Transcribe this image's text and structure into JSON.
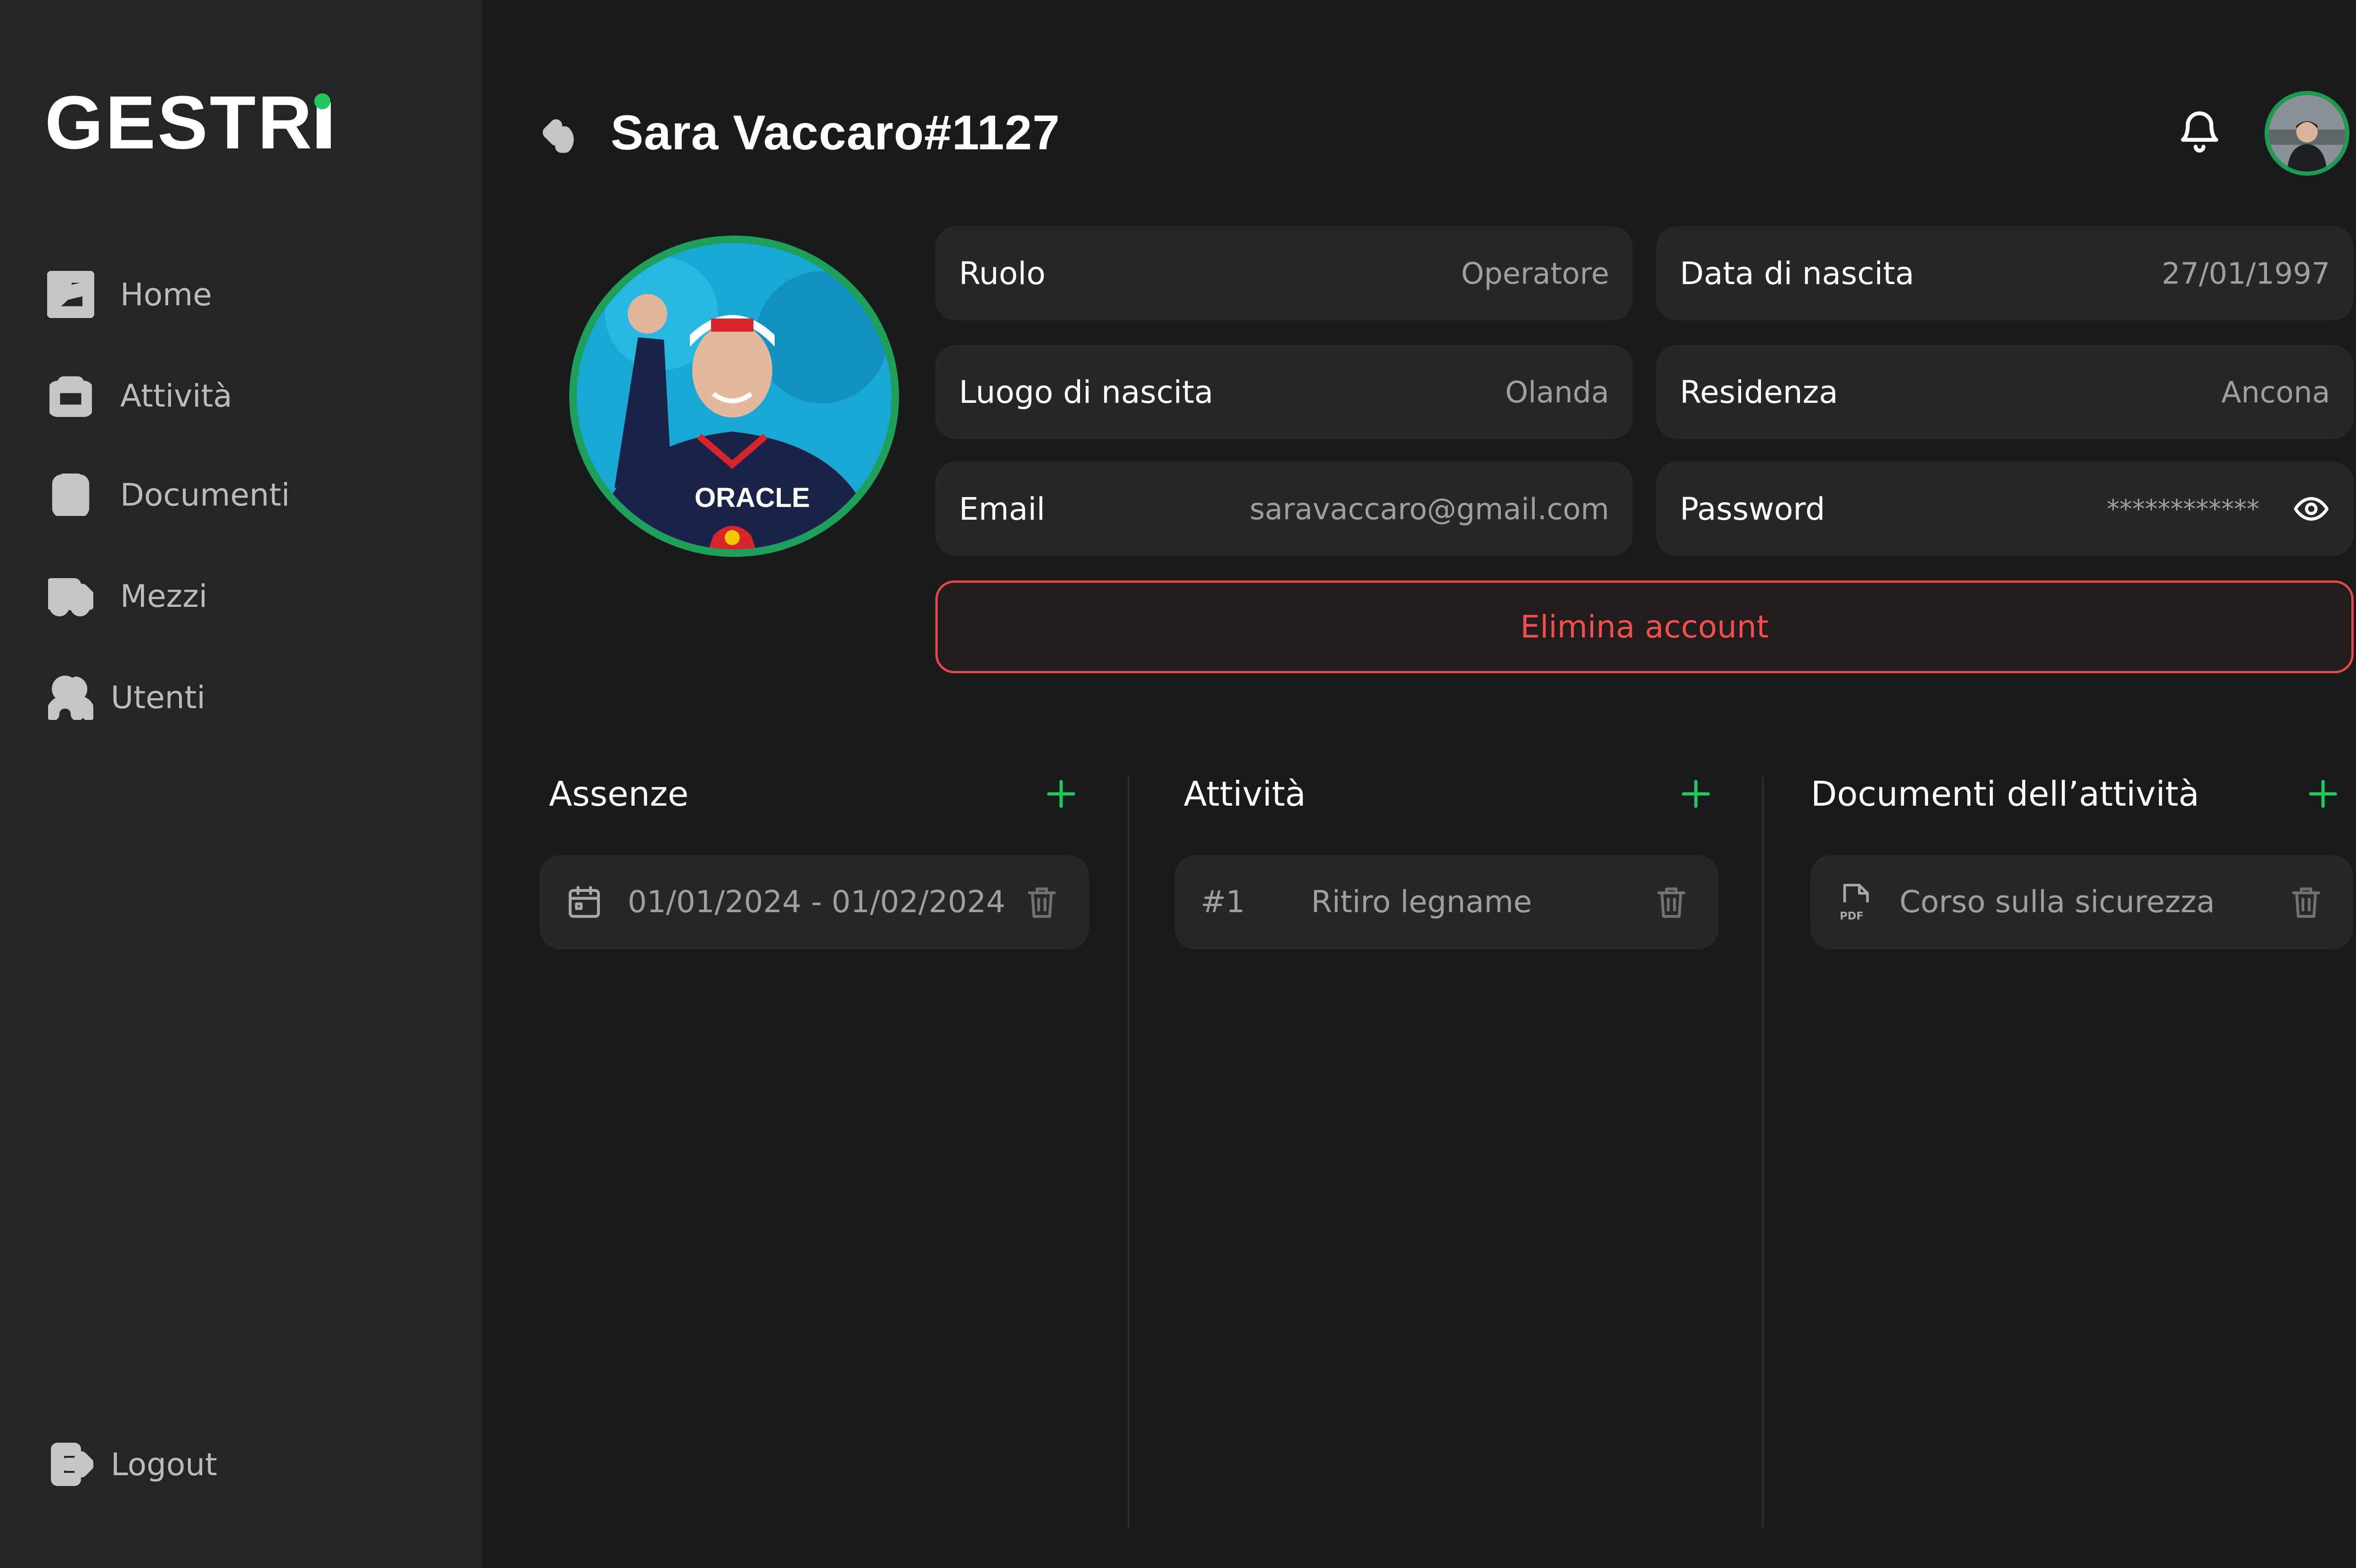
{
  "app": {
    "logo": "GESTR"
  },
  "sidebar": {
    "items": [
      {
        "label": "Home",
        "icon": "layout-icon"
      },
      {
        "label": "Attività",
        "icon": "briefcase-icon"
      },
      {
        "label": "Documenti",
        "icon": "clipboard-icon"
      },
      {
        "label": "Mezzi",
        "icon": "truck-icon"
      },
      {
        "label": "Utenti",
        "icon": "users-icon"
      }
    ],
    "logout": {
      "label": "Logout",
      "icon": "logout-icon"
    }
  },
  "header": {
    "title": "Sara Vaccaro#1127"
  },
  "profile": {
    "fields": [
      {
        "key": "Ruolo",
        "value": "Operatore"
      },
      {
        "key": "Data di nascita",
        "value": "27/01/1997"
      },
      {
        "key": "Luogo di nascita",
        "value": "Olanda"
      },
      {
        "key": "Residenza",
        "value": "Ancona"
      },
      {
        "key": "Email",
        "value": "saravaccaro@gmail.com"
      },
      {
        "key": "Password",
        "value": "************"
      }
    ],
    "delete_label": "Elimina account"
  },
  "sections": {
    "absences": {
      "title": "Assenze",
      "items": [
        {
          "text": "01/01/2024 - 01/02/2024"
        }
      ]
    },
    "activities": {
      "title": "Attività",
      "items": [
        {
          "id": "#1",
          "text": "Ritiro legname"
        }
      ]
    },
    "documents": {
      "title": "Documenti dell’attività",
      "items": [
        {
          "text": "Corso sulla sicurezza"
        }
      ]
    }
  },
  "colors": {
    "accent": "#22c55e",
    "danger": "#e54848",
    "background": "#191b1a",
    "sidebar": "#242526"
  }
}
